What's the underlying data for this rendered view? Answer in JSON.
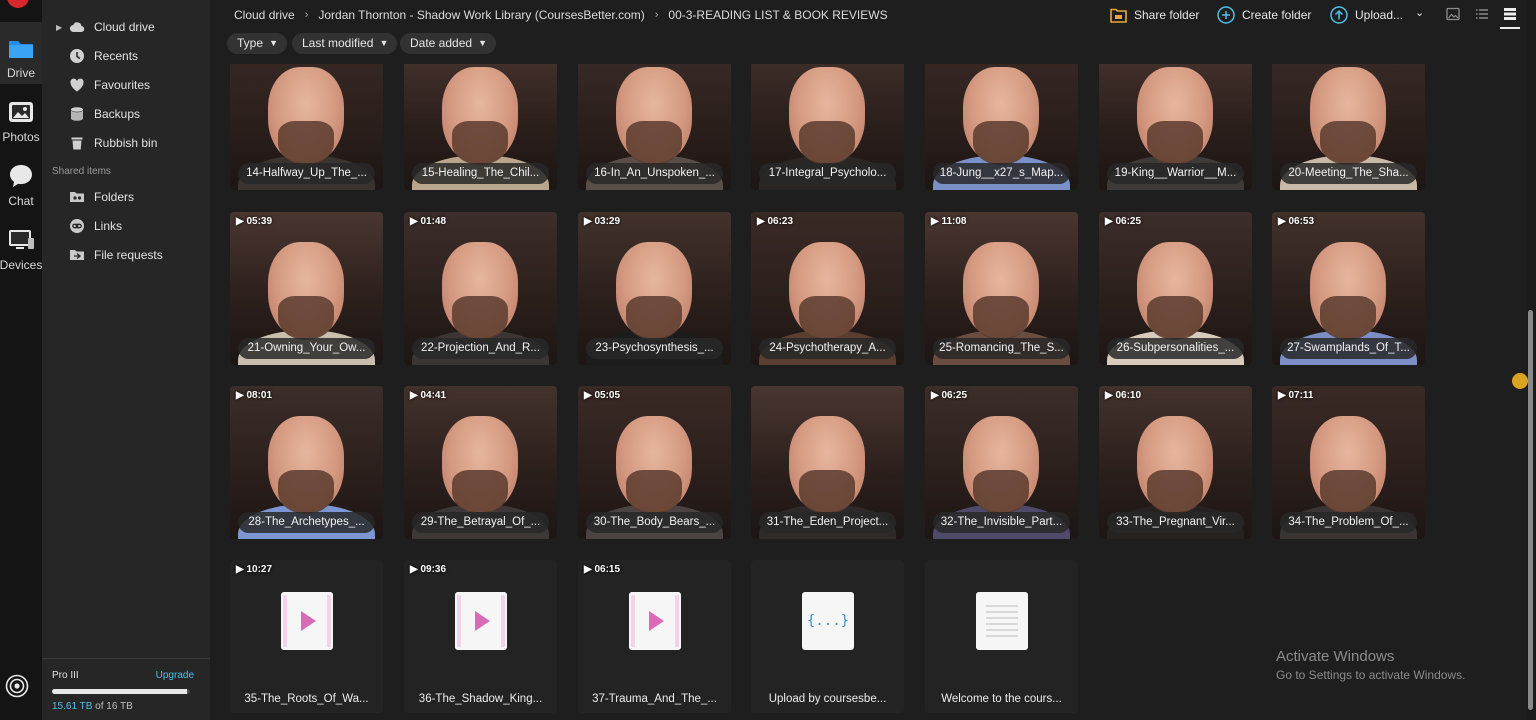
{
  "rail": {
    "items": [
      {
        "label": "Drive",
        "icon": "folder-icon"
      },
      {
        "label": "Photos",
        "icon": "image-icon"
      },
      {
        "label": "Chat",
        "icon": "chat-icon"
      },
      {
        "label": "Devices",
        "icon": "monitor-icon"
      }
    ],
    "bottom_icon": "sync-icon"
  },
  "sidebar": {
    "items": [
      {
        "label": "Cloud drive",
        "icon": "cloud-icon"
      },
      {
        "label": "Recents",
        "icon": "clock-icon"
      },
      {
        "label": "Favourites",
        "icon": "heart-icon"
      },
      {
        "label": "Backups",
        "icon": "database-icon"
      },
      {
        "label": "Rubbish bin",
        "icon": "trash-icon"
      }
    ],
    "shared_heading": "Shared items",
    "shared_items": [
      {
        "label": "Folders",
        "icon": "shared-folder-icon"
      },
      {
        "label": "Links",
        "icon": "link-icon"
      },
      {
        "label": "File requests",
        "icon": "file-request-icon"
      }
    ]
  },
  "storage": {
    "plan": "Pro III",
    "upgrade": "Upgrade",
    "used": "15.61 TB",
    "of": " of 16 TB",
    "fraction": 0.976
  },
  "breadcrumb": [
    "Cloud drive",
    "Jordan Thornton - Shadow Work Library (CoursesBetter.com)",
    "00-3-READING LIST & BOOK REVIEWS"
  ],
  "toolbar": {
    "share_folder": "Share folder",
    "create_folder": "Create folder",
    "upload": "Upload...",
    "chevron": "⌄"
  },
  "filters": [
    "Type",
    "Last modified",
    "Date added"
  ],
  "colors": {
    "accent_blue": "#4ec0e8",
    "share_orange": "#e8a73a",
    "video_pink": "#d96bb6"
  },
  "rows": [
    [
      {
        "name": "14-Halfway_Up_The_...",
        "duration": "",
        "shirt": "#3a3430"
      },
      {
        "name": "15-Healing_The_Chil...",
        "duration": "",
        "shirt": "#b9a58c"
      },
      {
        "name": "16-In_An_Unspoken_...",
        "duration": "",
        "shirt": "#5a4f48"
      },
      {
        "name": "17-Integral_Psycholo...",
        "duration": "",
        "shirt": "#2a2626"
      },
      {
        "name": "18-Jung__x27_s_Map...",
        "duration": "",
        "shirt": "#7a90c8"
      },
      {
        "name": "19-King__Warrior__M...",
        "duration": "",
        "shirt": "#3e3a3a"
      },
      {
        "name": "20-Meeting_The_Sha...",
        "duration": "",
        "shirt": "#c9b8a6"
      }
    ],
    [
      {
        "name": "21-Owning_Your_Ow...",
        "duration": "05:39",
        "shirt": "#c8bfae"
      },
      {
        "name": "22-Projection_And_R...",
        "duration": "01:48",
        "shirt": "#3a3636"
      },
      {
        "name": "23-Psychosynthesis_...",
        "duration": "03:29",
        "shirt": "#1c1c1c"
      },
      {
        "name": "24-Psychotherapy_A...",
        "duration": "06:23",
        "shirt": "#5a3e32"
      },
      {
        "name": "25-Romancing_The_S...",
        "duration": "11:08",
        "shirt": "#6a4c40"
      },
      {
        "name": "26-Subpersonalities_...",
        "duration": "06:25",
        "shirt": "#d8cabc"
      },
      {
        "name": "27-Swamplands_Of_T...",
        "duration": "06:53",
        "shirt": "#7b8fc6"
      }
    ],
    [
      {
        "name": "28-The_Archetypes_...",
        "duration": "08:01",
        "shirt": "#7b96d2"
      },
      {
        "name": "29-The_Betrayal_Of_...",
        "duration": "04:41",
        "shirt": "#3e3838"
      },
      {
        "name": "30-The_Body_Bears_...",
        "duration": "05:05",
        "shirt": "#4c4444"
      },
      {
        "name": "31-The_Eden_Project...",
        "duration": "",
        "shirt": "#2e2a2a"
      },
      {
        "name": "32-The_Invisible_Part...",
        "duration": "06:25",
        "shirt": "#504a6a"
      },
      {
        "name": "33-The_Pregnant_Vir...",
        "duration": "06:10",
        "shirt": "#262222"
      },
      {
        "name": "34-The_Problem_Of_...",
        "duration": "07:11",
        "shirt": "#3a3434"
      }
    ]
  ],
  "files": [
    {
      "name": "35-The_Roots_Of_Wa...",
      "duration": "10:27",
      "kind": "video",
      "icon": "video-file-icon"
    },
    {
      "name": "36-The_Shadow_King...",
      "duration": "09:36",
      "kind": "video",
      "icon": "video-file-icon"
    },
    {
      "name": "37-Trauma_And_The_...",
      "duration": "06:15",
      "kind": "video",
      "icon": "video-file-icon"
    },
    {
      "name": "Upload by coursesbe...",
      "duration": "",
      "kind": "code",
      "icon": "code-file-icon",
      "glyph": "{...}"
    },
    {
      "name": "Welcome to the cours...",
      "duration": "",
      "kind": "text",
      "icon": "text-file-icon"
    }
  ],
  "watermark": {
    "title": "Activate Windows",
    "subtitle": "Go to Settings to activate Windows."
  }
}
